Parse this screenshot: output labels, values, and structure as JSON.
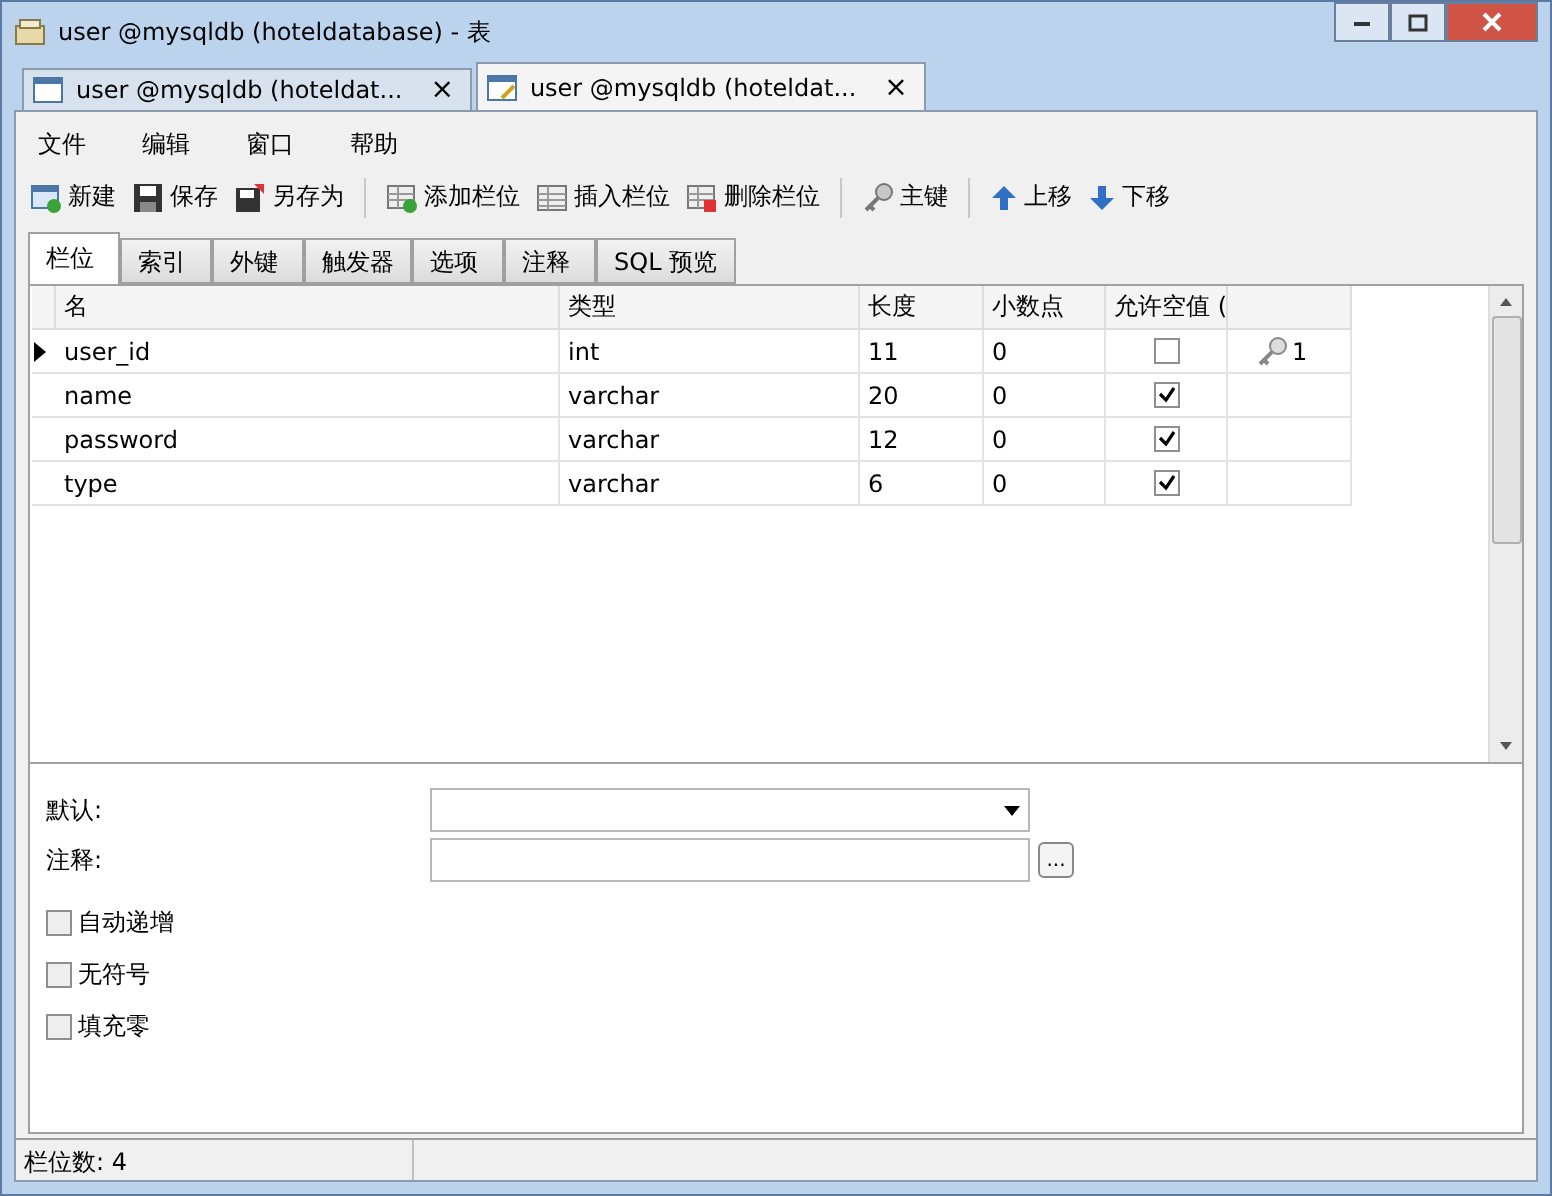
{
  "window": {
    "title": "user @mysqldb (hoteldatabase) - 表"
  },
  "doc_tabs": [
    {
      "label": "user @mysqldb (hoteldat...",
      "close": "×",
      "selected": false
    },
    {
      "label": "user @mysqldb (hoteldat...",
      "close": "×",
      "selected": true
    }
  ],
  "menu": [
    "文件",
    "编辑",
    "窗口",
    "帮助"
  ],
  "toolbar": [
    "新建",
    "保存",
    "另存为",
    "添加栏位",
    "插入栏位",
    "删除栏位",
    "主键",
    "上移",
    "下移"
  ],
  "tabs": [
    {
      "label": "栏位",
      "selected": true
    },
    {
      "label": "索引",
      "selected": false
    },
    {
      "label": "外键",
      "selected": false
    },
    {
      "label": "触发器",
      "selected": false
    },
    {
      "label": "选项",
      "selected": false
    },
    {
      "label": "注释",
      "selected": false
    },
    {
      "label": "SQL 预览",
      "selected": false
    }
  ],
  "table": {
    "columns": [
      "名",
      "类型",
      "长度",
      "小数点",
      "允许空值 ("
    ],
    "rows": [
      {
        "name": "user_id",
        "type": "int",
        "length": "11",
        "decimals": "0",
        "allow_null": false,
        "key": "1",
        "current": true
      },
      {
        "name": "name",
        "type": "varchar",
        "length": "20",
        "decimals": "0",
        "allow_null": true,
        "current": false
      },
      {
        "name": "password",
        "type": "varchar",
        "length": "12",
        "decimals": "0",
        "allow_null": true,
        "current": false
      },
      {
        "name": "type",
        "type": "varchar",
        "length": "6",
        "decimals": "0",
        "allow_null": true,
        "current": false
      }
    ]
  },
  "properties": {
    "default_label": "默认:",
    "comment_label": "注释:",
    "comment_button": "...",
    "options": [
      {
        "label": "自动递增",
        "checked": false
      },
      {
        "label": "无符号",
        "checked": false
      },
      {
        "label": "填充零",
        "checked": false
      }
    ]
  },
  "status_bar": "栏位数: 4"
}
